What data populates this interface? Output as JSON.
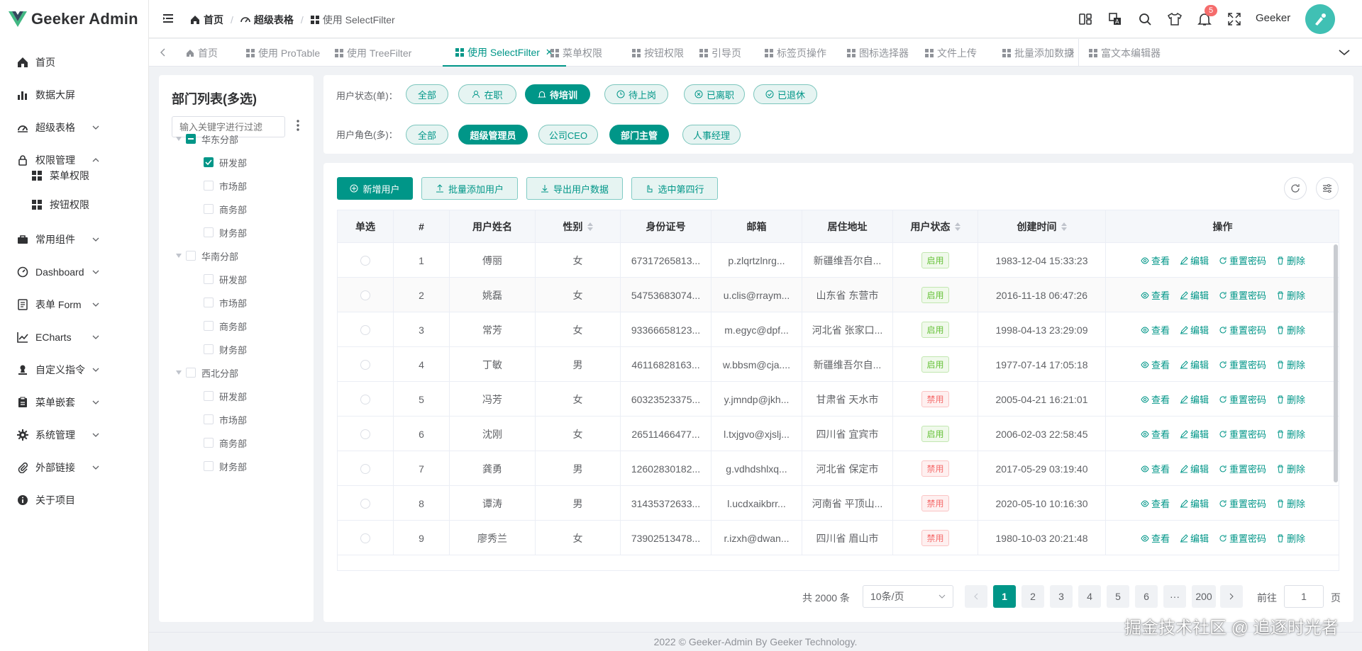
{
  "app": {
    "title": "Geeker Admin",
    "brand_color": "#009688"
  },
  "sidebar": {
    "items": [
      {
        "label": "首页",
        "icon": "home-icon"
      },
      {
        "label": "数据大屏",
        "icon": "bar-chart-icon"
      },
      {
        "label": "超级表格",
        "icon": "gauge-icon"
      },
      {
        "label": "权限管理",
        "icon": "lock-icon"
      },
      {
        "label": "菜单权限",
        "icon": "grid-icon"
      },
      {
        "label": "按钮权限",
        "icon": "grid-icon"
      },
      {
        "label": "常用组件",
        "icon": "briefcase-icon"
      },
      {
        "label": "Dashboard",
        "icon": "dashboard-icon"
      },
      {
        "label": "表单 Form",
        "icon": "form-icon"
      },
      {
        "label": "ECharts",
        "icon": "line-chart-icon"
      },
      {
        "label": "自定义指令",
        "icon": "stamp-icon"
      },
      {
        "label": "菜单嵌套",
        "icon": "clipboard-icon"
      },
      {
        "label": "系统管理",
        "icon": "gear-icon"
      },
      {
        "label": "外部链接",
        "icon": "paperclip-icon"
      },
      {
        "label": "关于项目",
        "icon": "info-icon"
      }
    ]
  },
  "header": {
    "breadcrumb": [
      "首页",
      "超级表格",
      "使用 SelectFilter"
    ],
    "notify_count": "5",
    "username": "Geeker"
  },
  "tabs": [
    {
      "label": "首页"
    },
    {
      "label": "使用 ProTable"
    },
    {
      "label": "使用 TreeFilter"
    },
    {
      "label": "使用 SelectFilter"
    },
    {
      "label": "菜单权限"
    },
    {
      "label": "按钮权限"
    },
    {
      "label": "引导页"
    },
    {
      "label": "标签页操作"
    },
    {
      "label": "图标选择器"
    },
    {
      "label": "文件上传"
    },
    {
      "label": "批量添加数据"
    },
    {
      "label": "富文本编辑器"
    }
  ],
  "tree": {
    "title": "部门列表(多选)",
    "placeholder": "输入关键字进行过滤",
    "nodes": [
      {
        "label": "华东分部",
        "level": 0,
        "state": "indeterminate"
      },
      {
        "label": "研发部",
        "level": 1,
        "state": "checked"
      },
      {
        "label": "市场部",
        "level": 1,
        "state": "unchecked"
      },
      {
        "label": "商务部",
        "level": 1,
        "state": "unchecked"
      },
      {
        "label": "财务部",
        "level": 1,
        "state": "unchecked"
      },
      {
        "label": "华南分部",
        "level": 0,
        "state": "unchecked"
      },
      {
        "label": "研发部",
        "level": 1,
        "state": "unchecked"
      },
      {
        "label": "市场部",
        "level": 1,
        "state": "unchecked"
      },
      {
        "label": "商务部",
        "level": 1,
        "state": "unchecked"
      },
      {
        "label": "财务部",
        "level": 1,
        "state": "unchecked"
      },
      {
        "label": "西北分部",
        "level": 0,
        "state": "unchecked"
      },
      {
        "label": "研发部",
        "level": 1,
        "state": "unchecked"
      },
      {
        "label": "市场部",
        "level": 1,
        "state": "unchecked"
      },
      {
        "label": "商务部",
        "level": 1,
        "state": "unchecked"
      },
      {
        "label": "财务部",
        "level": 1,
        "state": "unchecked"
      }
    ]
  },
  "filters": {
    "status_label": "用户状态(单)：",
    "status_options": [
      {
        "label": "全部",
        "active": false
      },
      {
        "label": "在职",
        "active": false
      },
      {
        "label": "待培训",
        "active": true
      },
      {
        "label": "待上岗",
        "active": false
      },
      {
        "label": "已离职",
        "active": false
      },
      {
        "label": "已退休",
        "active": false
      }
    ],
    "role_label": "用户角色(多)：",
    "role_options": [
      {
        "label": "全部",
        "active": false
      },
      {
        "label": "超级管理员",
        "active": true
      },
      {
        "label": "公司CEO",
        "active": false
      },
      {
        "label": "部门主管",
        "active": true
      },
      {
        "label": "人事经理",
        "active": false
      }
    ]
  },
  "toolbar": {
    "add": "新增用户",
    "batch_add": "批量添加用户",
    "export": "导出用户数据",
    "select_fourth": "选中第四行"
  },
  "table": {
    "headers": [
      "单选",
      "#",
      "用户姓名",
      "性别",
      "身份证号",
      "邮箱",
      "居住地址",
      "用户状态",
      "创建时间",
      "操作"
    ],
    "actions": [
      "查看",
      "编辑",
      "重置密码",
      "删除"
    ],
    "rows": [
      {
        "index": "1",
        "name": "傅丽",
        "gender": "女",
        "id": "67317265813...",
        "email": "p.zlqrtzlnrg...",
        "address": "新疆维吾尔自...",
        "status": "启用",
        "created": "1983-12-04 15:33:23"
      },
      {
        "index": "2",
        "name": "姚磊",
        "gender": "女",
        "id": "54753683074...",
        "email": "u.clis@rraym...",
        "address": "山东省 东营市",
        "status": "启用",
        "created": "2016-11-18 06:47:26"
      },
      {
        "index": "3",
        "name": "常芳",
        "gender": "女",
        "id": "93366658123...",
        "email": "m.egyc@dpf...",
        "address": "河北省 张家口...",
        "status": "启用",
        "created": "1998-04-13 23:29:09"
      },
      {
        "index": "4",
        "name": "丁敏",
        "gender": "男",
        "id": "46116828163...",
        "email": "w.bbsm@cja....",
        "address": "新疆维吾尔自...",
        "status": "启用",
        "created": "1977-07-14 17:05:18"
      },
      {
        "index": "5",
        "name": "冯芳",
        "gender": "女",
        "id": "60323523375...",
        "email": "y.jmndp@jkh...",
        "address": "甘肃省 天水市",
        "status": "禁用",
        "created": "2005-04-21 16:21:01"
      },
      {
        "index": "6",
        "name": "沈刚",
        "gender": "女",
        "id": "26511466477...",
        "email": "l.txjgvo@xjslj...",
        "address": "四川省 宜宾市",
        "status": "启用",
        "created": "2006-02-03 22:58:45"
      },
      {
        "index": "7",
        "name": "龚勇",
        "gender": "男",
        "id": "12602830182...",
        "email": "g.vdhdshlxq...",
        "address": "河北省 保定市",
        "status": "禁用",
        "created": "2017-05-29 03:19:40"
      },
      {
        "index": "8",
        "name": "谭涛",
        "gender": "男",
        "id": "31435372633...",
        "email": "l.ucdxaikbrr...",
        "address": "河南省 平顶山...",
        "status": "禁用",
        "created": "2020-05-10 10:16:30"
      },
      {
        "index": "9",
        "name": "廖秀兰",
        "gender": "女",
        "id": "73902513478...",
        "email": "r.izxh@dwan...",
        "address": "四川省 眉山市",
        "status": "禁用",
        "created": "1980-10-03 20:21:48"
      }
    ]
  },
  "pagination": {
    "total": "共 2000 条",
    "size": "10条/页",
    "pages": [
      "1",
      "2",
      "3",
      "4",
      "5",
      "6",
      "···",
      "200"
    ],
    "current": "1",
    "goto_prefix": "前往",
    "goto_value": "1",
    "goto_suffix": "页"
  },
  "footer": {
    "text": "2022 © Geeker-Admin By Geeker Technology."
  },
  "watermark": {
    "text": "掘金技术社区 @ 追逐时光者"
  }
}
